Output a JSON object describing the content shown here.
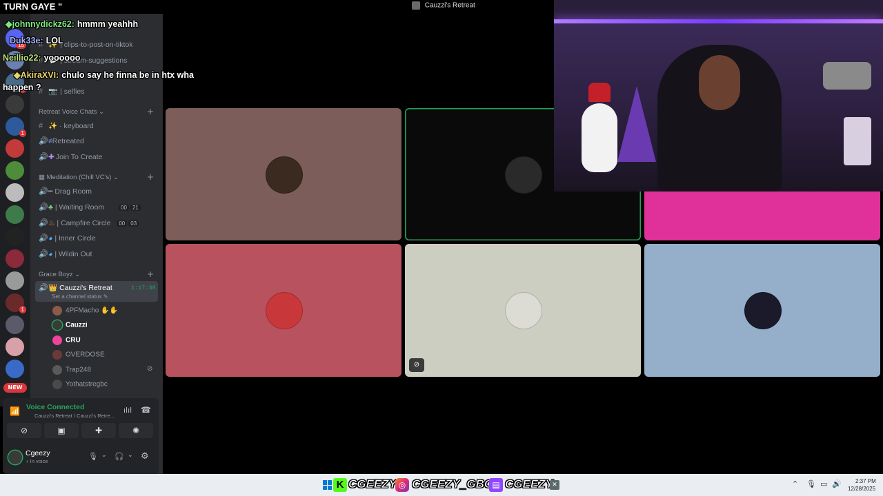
{
  "stream_title": "TURN GAYE \"",
  "window_title": "Cauzzi's Retreat",
  "chat": [
    {
      "user": "johnnydickz62:",
      "message": "hmmm yeahhh",
      "color": "#7ee87e"
    },
    {
      "user": "Duk33e:",
      "message": "LOL",
      "color": "#a6b4ff"
    },
    {
      "user": "Neillio22:",
      "message": "yoooooo",
      "color": "#b8e07a"
    },
    {
      "user": "AkiraXVI:",
      "message": "chulo say he finna be in htx wha",
      "color": "#e8d56a"
    },
    {
      "user": "",
      "message": "happen ?",
      "color": "#ffffff"
    }
  ],
  "server_badges": [
    "15",
    "4",
    "1",
    "1",
    "NEW"
  ],
  "top_channels": [
    {
      "icon": "#",
      "label": "| clips-to-post-on-tiktok"
    },
    {
      "icon": "#",
      "label": "| stream-suggestions"
    },
    {
      "icon": "#",
      "label": "| selfies"
    }
  ],
  "categories": {
    "retreat": "Retreat Voice Chats",
    "meditation": "Meditation (Chill VC's)",
    "grace": "Grace Boyz"
  },
  "retreat_channels": [
    {
      "label": "keyboard"
    },
    {
      "label": "Retreated"
    },
    {
      "label": "Join To Create"
    }
  ],
  "meditation_channels": [
    {
      "label": "Drag Room"
    },
    {
      "label": "| Waiting Room",
      "c1": "00",
      "c2": "21"
    },
    {
      "label": "| Campfire Circle",
      "c1": "00",
      "c2": "03"
    },
    {
      "label": "| Inner Circle"
    },
    {
      "label": "| Wildin Out"
    }
  ],
  "active_channel": {
    "label": "Cauzzi's Retreat",
    "timer": "1:17:38",
    "status": "Set a channel status"
  },
  "members": [
    "4PFMacho",
    "Cauzzi",
    "CRU",
    "OVERDOSE",
    "Trap248",
    "Yothatstregbc"
  ],
  "voice": {
    "status": "Voice Connected",
    "location": "Cauzzi's Retreat / Cauzzi's Retre..."
  },
  "user": {
    "name": "Cgeezy",
    "status": "In voice"
  },
  "socials": {
    "kick": "CGEEZY",
    "instagram": "CGEEZY_GBC",
    "twitch": "CGEEZY"
  },
  "clock": {
    "time": "2:37 PM",
    "date": "12/28/2025"
  },
  "tile_colors": [
    "#7d5d5a",
    "#0a0a0a",
    "#e0319a",
    "#b8525e",
    "#cccec2",
    "#95aec9"
  ]
}
